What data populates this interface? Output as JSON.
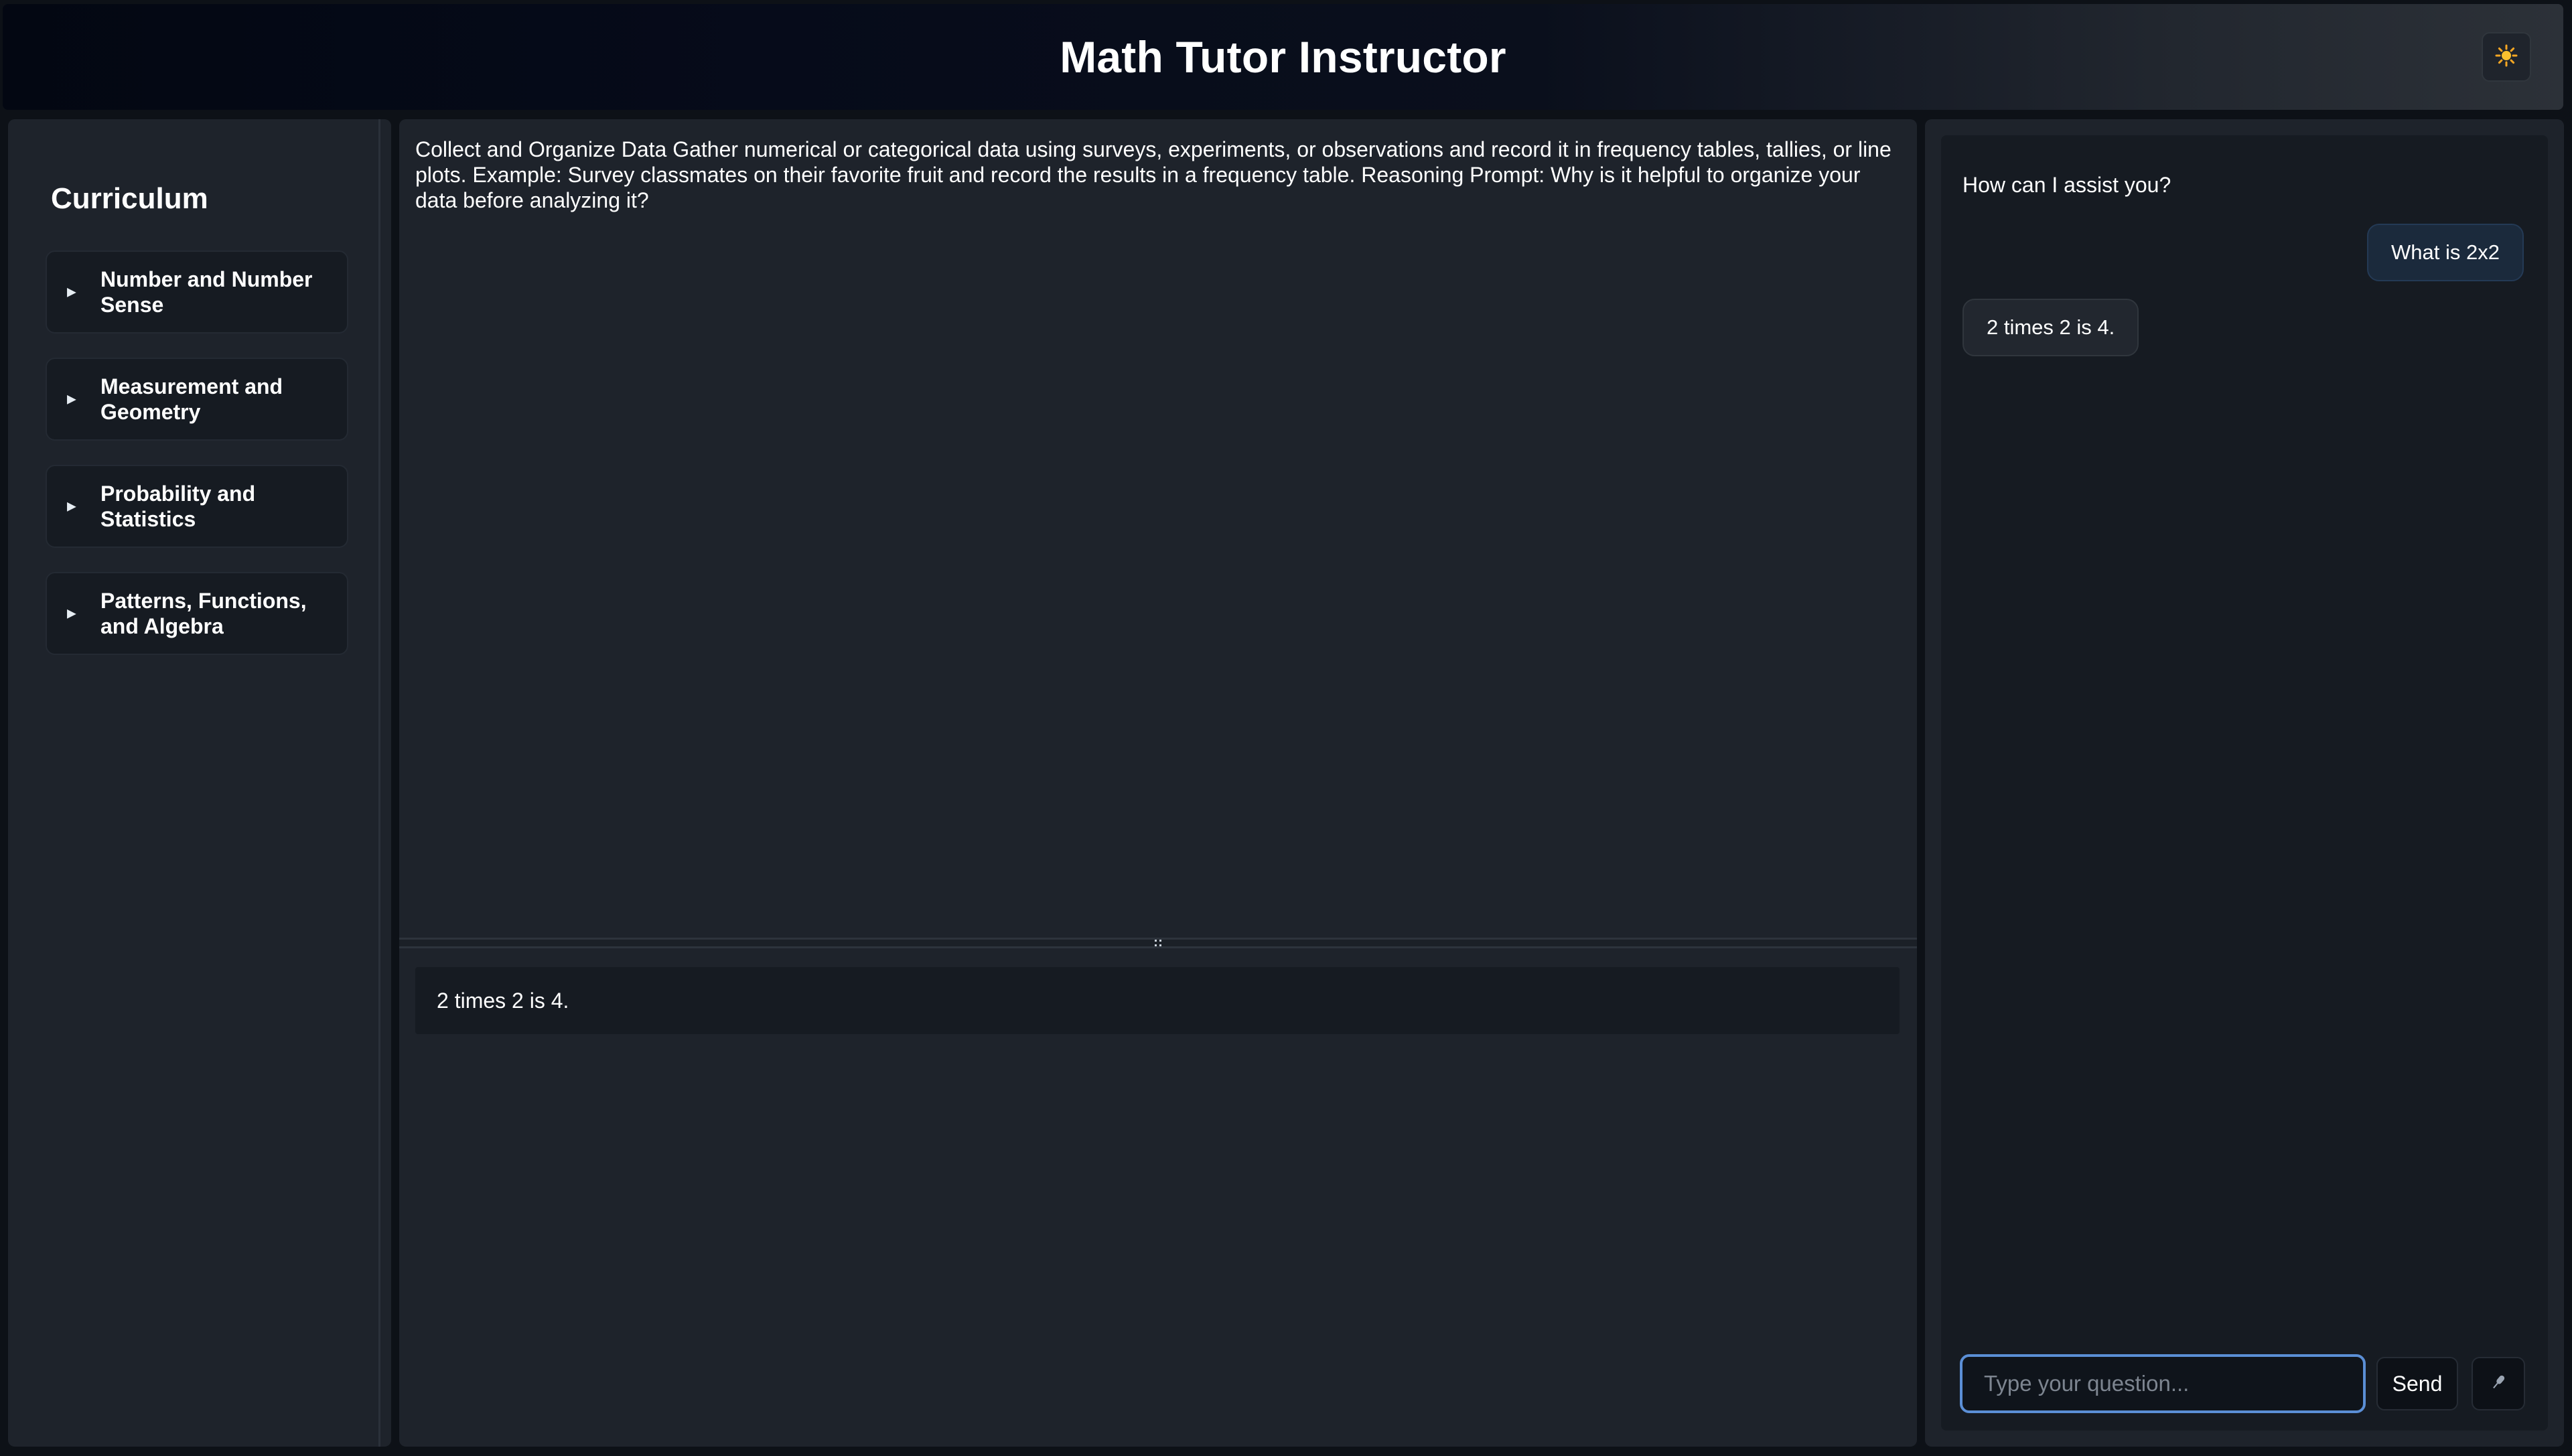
{
  "header": {
    "title": "Math Tutor Instructor",
    "theme_icon": "sun-icon"
  },
  "sidebar": {
    "title": "Curriculum",
    "items": [
      {
        "label": "Number and Number Sense"
      },
      {
        "label": "Measurement and Geometry"
      },
      {
        "label": "Probability and Statistics"
      },
      {
        "label": "Patterns, Functions, and Algebra"
      }
    ]
  },
  "main": {
    "lesson_text": "Collect and Organize Data Gather numerical or categorical data using surveys, experiments, or observations and record it in frequency tables, tallies, or line plots. Example: Survey classmates on their favorite fruit and record the results in a frequency table. Reasoning Prompt: Why is it helpful to organize your data before analyzing it?",
    "answer_text": "2 times 2 is 4."
  },
  "chat": {
    "greeting": "How can I assist you?",
    "messages": [
      {
        "role": "user",
        "text": "What is 2x2"
      },
      {
        "role": "assistant",
        "text": "2 times 2 is 4."
      }
    ],
    "input_placeholder": "Type your question...",
    "send_label": "Send",
    "mic_icon": "microphone-icon"
  },
  "colors": {
    "background": "#0d1117",
    "panel": "#1e232b",
    "input_focus": "#5b8fd6",
    "user_bubble": "#1b2a3c"
  }
}
